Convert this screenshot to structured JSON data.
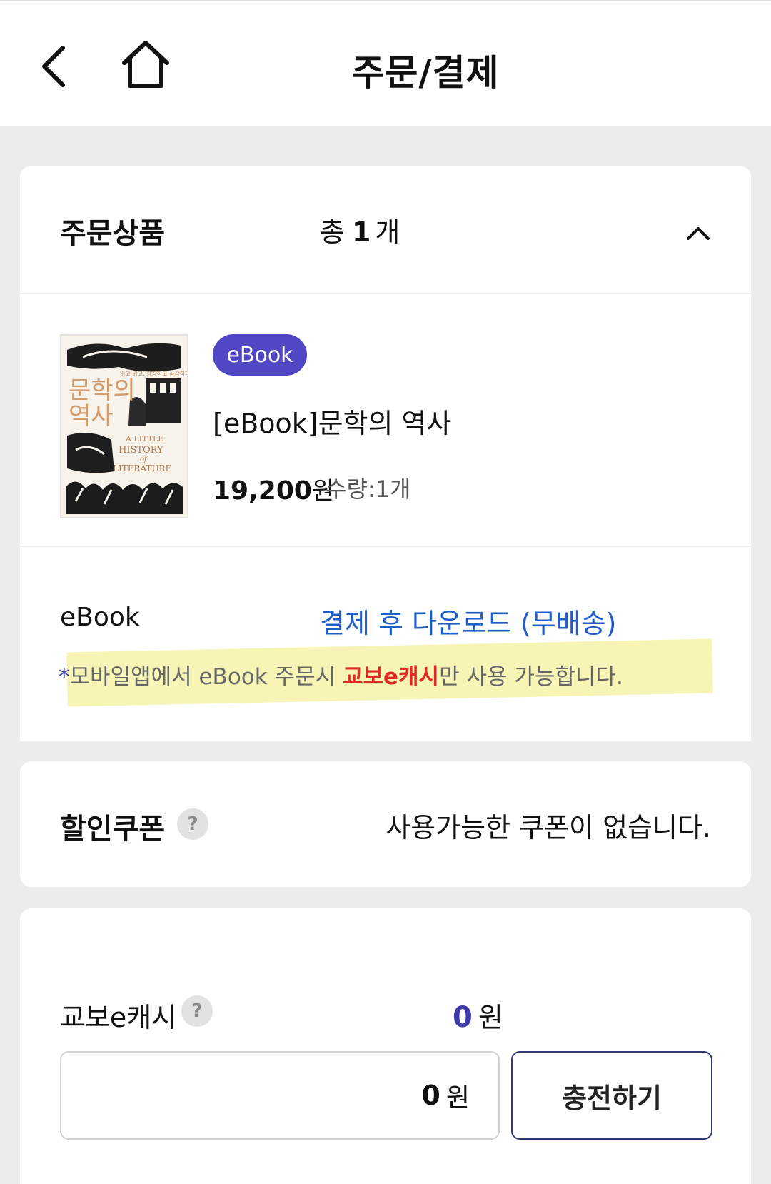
{
  "header": {
    "title": "주문/결제",
    "back_icon": "chevron-left-icon",
    "home_icon": "home-icon"
  },
  "order": {
    "section_title": "주문상품",
    "total_prefix": "총",
    "total_count": "1",
    "total_suffix": "개",
    "toggle_icon": "chevron-up-icon",
    "item": {
      "badge": "eBook",
      "title": "[eBook]문학의 역사",
      "price": "19,200",
      "price_unit": "원",
      "quantity": "수량:1개",
      "cover": {
        "title_ko_1": "문학의",
        "title_ko_2": "역사",
        "tagline": "읽고 읽고, 상상하고 공감하다",
        "title_en_1": "A LITTLE",
        "title_en_2": "HISTORY",
        "title_en_3": "of",
        "title_en_4": "LITERATURE"
      }
    },
    "delivery": {
      "label": "eBook",
      "value": "결제 후 다운로드 (무배송)"
    },
    "notice": {
      "star": "*",
      "before": "모바일앱에서 eBook 주문시 ",
      "emphasis": "교보e캐시",
      "after": "만 사용 가능합니다."
    }
  },
  "coupon": {
    "section_title": "할인쿠폰",
    "help": "?",
    "message": "사용가능한 쿠폰이 없습니다."
  },
  "cash": {
    "label": "교보e캐시",
    "help": "?",
    "balance": "0",
    "balance_unit": "원",
    "input_value": "0",
    "input_unit": "원",
    "charge_button": "충전하기"
  },
  "colors": {
    "accent_purple": "#5146c4",
    "link_blue": "#1f5ec9",
    "emphasis_red": "#e02a2a",
    "highlight_yellow": "#f4f3a8",
    "button_border": "#2f3a74"
  }
}
